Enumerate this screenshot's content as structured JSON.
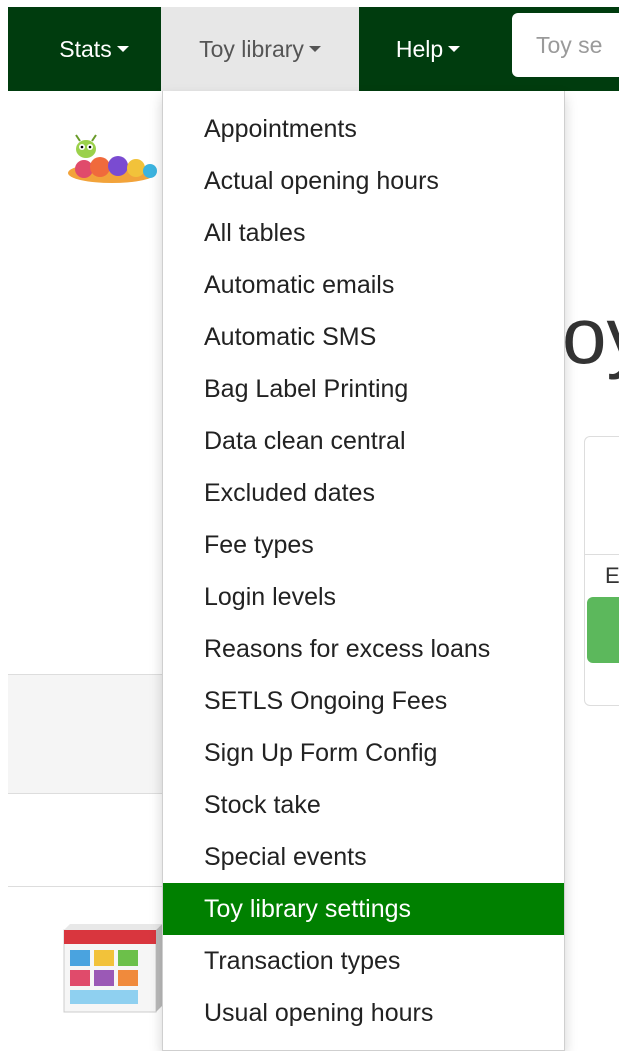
{
  "navbar": {
    "stats_label": "Stats",
    "toy_library_label": "Toy library",
    "help_label": "Help",
    "search_placeholder": "Toy se"
  },
  "background": {
    "heading_fragment": "oy",
    "panel_letter": "E"
  },
  "dropdown": {
    "items": [
      {
        "label": "Appointments"
      },
      {
        "label": "Actual opening hours"
      },
      {
        "label": "All tables"
      },
      {
        "label": "Automatic emails"
      },
      {
        "label": "Automatic SMS"
      },
      {
        "label": "Bag Label Printing"
      },
      {
        "label": "Data clean central"
      },
      {
        "label": "Excluded dates"
      },
      {
        "label": "Fee types"
      },
      {
        "label": "Login levels"
      },
      {
        "label": "Reasons for excess loans"
      },
      {
        "label": "SETLS Ongoing Fees"
      },
      {
        "label": "Sign Up Form Config"
      },
      {
        "label": "Stock take"
      },
      {
        "label": "Special events"
      },
      {
        "label": "Toy library settings",
        "active": true
      },
      {
        "label": "Transaction types"
      },
      {
        "label": "Usual opening hours"
      }
    ]
  },
  "colors": {
    "navbar_bg": "#003c0e",
    "active_item_bg": "#008000",
    "open_nav_bg": "#e7e7e7",
    "success_green": "#5cb85c"
  }
}
